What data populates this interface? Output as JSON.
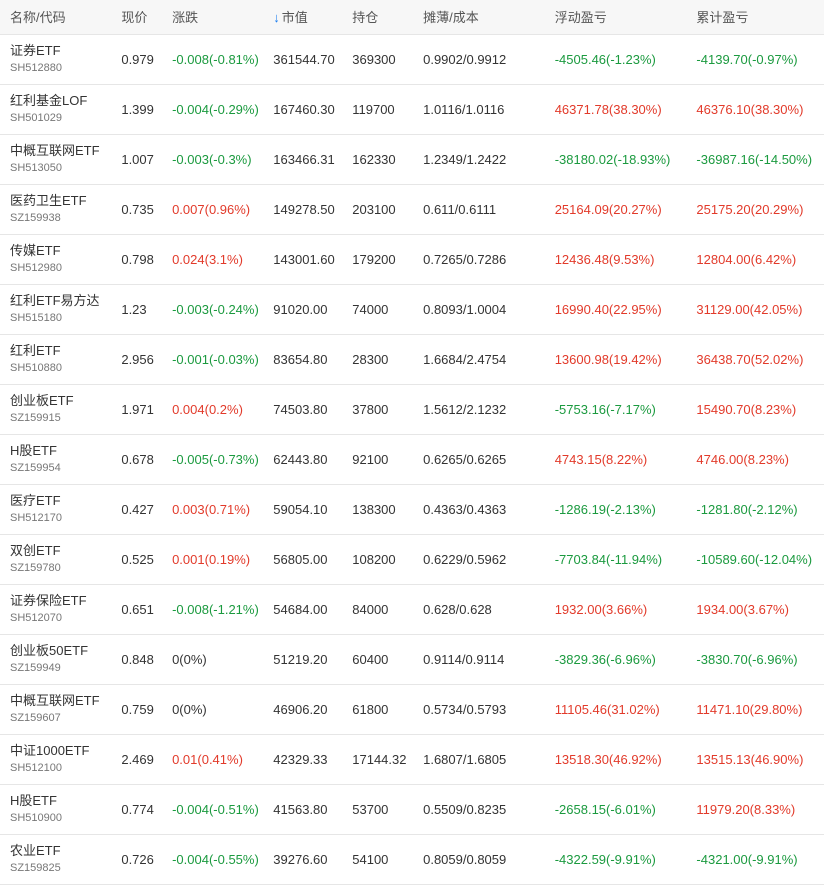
{
  "colors": {
    "up": "#e23a2a",
    "down": "#1b9a3f",
    "accent": "#1e7ff0"
  },
  "header": {
    "name_code": "名称/代码",
    "price": "现价",
    "change": "涨跌",
    "sort_icon": "arrow-down-icon",
    "market_value": "市值",
    "holding": "持仓",
    "cost": "摊薄/成本",
    "float_pl": "浮动盈亏",
    "total_pl": "累计盈亏"
  },
  "rows": [
    {
      "name": "证券ETF",
      "code": "SH512880",
      "price": "0.979",
      "change": "-0.008(-0.81%)",
      "change_dir": "down",
      "market_value": "361544.70",
      "holding": "369300",
      "cost": "0.9902/0.9912",
      "float_pl": "-4505.46(-1.23%)",
      "float_dir": "down",
      "total_pl": "-4139.70(-0.97%)",
      "total_dir": "down"
    },
    {
      "name": "红利基金LOF",
      "code": "SH501029",
      "price": "1.399",
      "change": "-0.004(-0.29%)",
      "change_dir": "down",
      "market_value": "167460.30",
      "holding": "119700",
      "cost": "1.0116/1.0116",
      "float_pl": "46371.78(38.30%)",
      "float_dir": "up",
      "total_pl": "46376.10(38.30%)",
      "total_dir": "up"
    },
    {
      "name": "中概互联网ETF",
      "code": "SH513050",
      "price": "1.007",
      "change": "-0.003(-0.3%)",
      "change_dir": "down",
      "market_value": "163466.31",
      "holding": "162330",
      "cost": "1.2349/1.2422",
      "float_pl": "-38180.02(-18.93%)",
      "float_dir": "down",
      "total_pl": "-36987.16(-14.50%)",
      "total_dir": "down"
    },
    {
      "name": "医药卫生ETF",
      "code": "SZ159938",
      "price": "0.735",
      "change": "0.007(0.96%)",
      "change_dir": "up",
      "market_value": "149278.50",
      "holding": "203100",
      "cost": "0.611/0.6111",
      "float_pl": "25164.09(20.27%)",
      "float_dir": "up",
      "total_pl": "25175.20(20.29%)",
      "total_dir": "up"
    },
    {
      "name": "传媒ETF",
      "code": "SH512980",
      "price": "0.798",
      "change": "0.024(3.1%)",
      "change_dir": "up",
      "market_value": "143001.60",
      "holding": "179200",
      "cost": "0.7265/0.7286",
      "float_pl": "12436.48(9.53%)",
      "float_dir": "up",
      "total_pl": "12804.00(6.42%)",
      "total_dir": "up"
    },
    {
      "name": "红利ETF易方达",
      "code": "SH515180",
      "price": "1.23",
      "change": "-0.003(-0.24%)",
      "change_dir": "down",
      "market_value": "91020.00",
      "holding": "74000",
      "cost": "0.8093/1.0004",
      "float_pl": "16990.40(22.95%)",
      "float_dir": "up",
      "total_pl": "31129.00(42.05%)",
      "total_dir": "up"
    },
    {
      "name": "红利ETF",
      "code": "SH510880",
      "price": "2.956",
      "change": "-0.001(-0.03%)",
      "change_dir": "down",
      "market_value": "83654.80",
      "holding": "28300",
      "cost": "1.6684/2.4754",
      "float_pl": "13600.98(19.42%)",
      "float_dir": "up",
      "total_pl": "36438.70(52.02%)",
      "total_dir": "up"
    },
    {
      "name": "创业板ETF",
      "code": "SZ159915",
      "price": "1.971",
      "change": "0.004(0.2%)",
      "change_dir": "up",
      "market_value": "74503.80",
      "holding": "37800",
      "cost": "1.5612/2.1232",
      "float_pl": "-5753.16(-7.17%)",
      "float_dir": "down",
      "total_pl": "15490.70(8.23%)",
      "total_dir": "up"
    },
    {
      "name": "H股ETF",
      "code": "SZ159954",
      "price": "0.678",
      "change": "-0.005(-0.73%)",
      "change_dir": "down",
      "market_value": "62443.80",
      "holding": "92100",
      "cost": "0.6265/0.6265",
      "float_pl": "4743.15(8.22%)",
      "float_dir": "up",
      "total_pl": "4746.00(8.23%)",
      "total_dir": "up"
    },
    {
      "name": "医疗ETF",
      "code": "SH512170",
      "price": "0.427",
      "change": "0.003(0.71%)",
      "change_dir": "up",
      "market_value": "59054.10",
      "holding": "138300",
      "cost": "0.4363/0.4363",
      "float_pl": "-1286.19(-2.13%)",
      "float_dir": "down",
      "total_pl": "-1281.80(-2.12%)",
      "total_dir": "down"
    },
    {
      "name": "双创ETF",
      "code": "SZ159780",
      "price": "0.525",
      "change": "0.001(0.19%)",
      "change_dir": "up",
      "market_value": "56805.00",
      "holding": "108200",
      "cost": "0.6229/0.5962",
      "float_pl": "-7703.84(-11.94%)",
      "float_dir": "down",
      "total_pl": "-10589.60(-12.04%)",
      "total_dir": "down"
    },
    {
      "name": "证券保险ETF",
      "code": "SH512070",
      "price": "0.651",
      "change": "-0.008(-1.21%)",
      "change_dir": "down",
      "market_value": "54684.00",
      "holding": "84000",
      "cost": "0.628/0.628",
      "float_pl": "1932.00(3.66%)",
      "float_dir": "up",
      "total_pl": "1934.00(3.67%)",
      "total_dir": "up"
    },
    {
      "name": "创业板50ETF",
      "code": "SZ159949",
      "price": "0.848",
      "change": "0(0%)",
      "change_dir": "flat",
      "market_value": "51219.20",
      "holding": "60400",
      "cost": "0.9114/0.9114",
      "float_pl": "-3829.36(-6.96%)",
      "float_dir": "down",
      "total_pl": "-3830.70(-6.96%)",
      "total_dir": "down"
    },
    {
      "name": "中概互联网ETF",
      "code": "SZ159607",
      "price": "0.759",
      "change": "0(0%)",
      "change_dir": "flat",
      "market_value": "46906.20",
      "holding": "61800",
      "cost": "0.5734/0.5793",
      "float_pl": "11105.46(31.02%)",
      "float_dir": "up",
      "total_pl": "11471.10(29.80%)",
      "total_dir": "up"
    },
    {
      "name": "中证1000ETF",
      "code": "SH512100",
      "price": "2.469",
      "change": "0.01(0.41%)",
      "change_dir": "up",
      "market_value": "42329.33",
      "holding": "17144.32",
      "cost": "1.6807/1.6805",
      "float_pl": "13518.30(46.92%)",
      "float_dir": "up",
      "total_pl": "13515.13(46.90%)",
      "total_dir": "up"
    },
    {
      "name": "H股ETF",
      "code": "SH510900",
      "price": "0.774",
      "change": "-0.004(-0.51%)",
      "change_dir": "down",
      "market_value": "41563.80",
      "holding": "53700",
      "cost": "0.5509/0.8235",
      "float_pl": "-2658.15(-6.01%)",
      "float_dir": "down",
      "total_pl": "11979.20(8.33%)",
      "total_dir": "up"
    },
    {
      "name": "农业ETF",
      "code": "SZ159825",
      "price": "0.726",
      "change": "-0.004(-0.55%)",
      "change_dir": "down",
      "market_value": "39276.60",
      "holding": "54100",
      "cost": "0.8059/0.8059",
      "float_pl": "-4322.59(-9.91%)",
      "float_dir": "down",
      "total_pl": "-4321.00(-9.91%)",
      "total_dir": "down"
    }
  ]
}
